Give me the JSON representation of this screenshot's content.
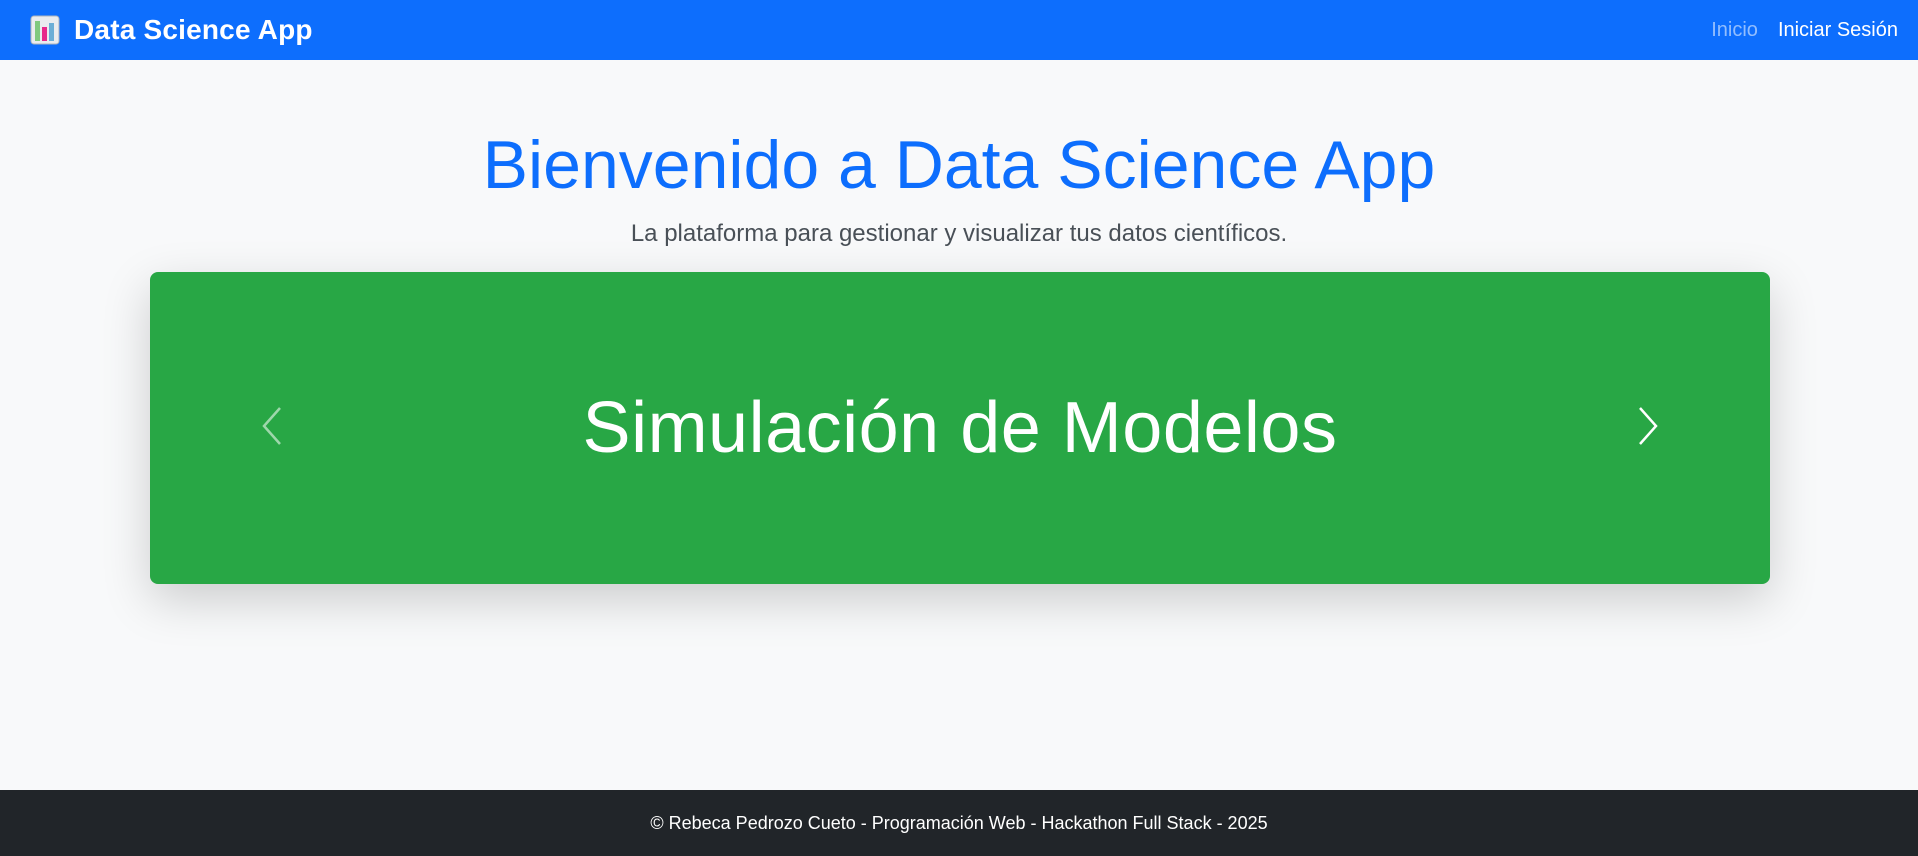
{
  "navbar": {
    "brand_icon": "bar-chart-icon",
    "brand_title": "Data Science App",
    "links": [
      {
        "label": "Inicio",
        "active": false
      },
      {
        "label": "Iniciar Sesión",
        "active": true
      }
    ],
    "bg_color": "#0d6efd"
  },
  "hero": {
    "title": "Bienvenido a Data Science App",
    "subtitle": "La plataforma para gestionar y visualizar tus datos científicos."
  },
  "carousel": {
    "slide_title": "Simulación de Modelos",
    "bg_color": "#28a745",
    "prev_icon": "chevron-left-icon",
    "next_icon": "chevron-right-icon"
  },
  "footer": {
    "text": "© Rebeca Pedrozo Cueto - Programación Web - Hackathon Full Stack - 2025",
    "bg_color": "#212529"
  }
}
